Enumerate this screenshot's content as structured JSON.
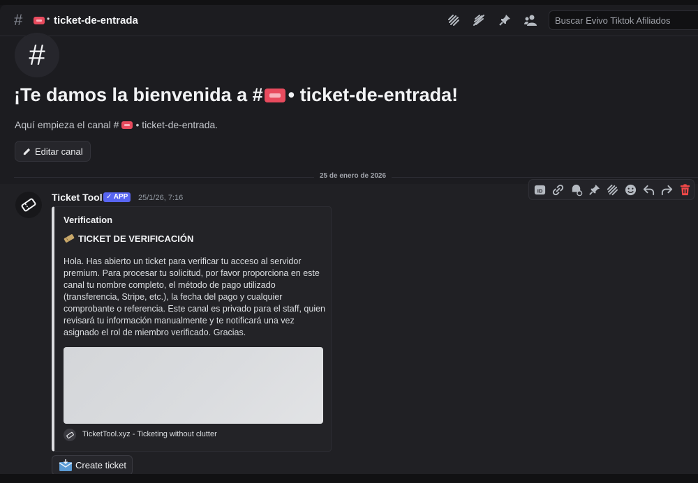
{
  "header": {
    "channel_prefix_icon": "hash-icon",
    "channel_emoji": "ticket-emoji",
    "separator": "•",
    "channel_name": "ticket-de-entrada",
    "icons": [
      "threads-icon",
      "mute-icon",
      "pin-icon",
      "members-icon"
    ],
    "search_placeholder": "Buscar Evivo Tiktok Afiliados"
  },
  "welcome": {
    "title_prefix": "¡Te damos la bienvenida a #",
    "title_suffix": "• ticket-de-entrada!",
    "subtitle_prefix": "Aquí empieza el canal #",
    "subtitle_suffix": "• ticket-de-entrada.",
    "edit_button": "Editar canal"
  },
  "divider": {
    "date": "25 de enero de 2026"
  },
  "message": {
    "author": "Ticket Tool",
    "badge": "✓ APP",
    "timestamp": "25/1/26, 7:16",
    "toolbar_icons": [
      "id-icon",
      "link-icon",
      "reminder-icon",
      "pin-icon",
      "thread-icon",
      "emoji-icon",
      "reply-icon",
      "forward-icon",
      "delete-icon"
    ],
    "embed": {
      "title": "Verification",
      "subtitle": "TICKET DE VERIFICACIÓN",
      "body": "Hola. Has abierto un ticket para verificar tu acceso al servidor premium. Para procesar tu solicitud, por favor proporciona en este canal tu nombre completo, el método de pago utilizado (transferencia, Stripe, etc.), la fecha del pago y cualquier comprobante o referencia. Este canal es privado para el staff, quien revisará tu información manualmente y te notificará una vez asignado el rol de miembro verificado. Gracias.",
      "footer": "TicketTool.xyz - Ticketing without clutter"
    },
    "button": "Create ticket"
  },
  "colors": {
    "background": "#1c1c20",
    "embed_border": "#dcdde0",
    "app_badge": "#5865f2",
    "delete": "#f04848",
    "ticket_emoji": "#e84b5e"
  }
}
